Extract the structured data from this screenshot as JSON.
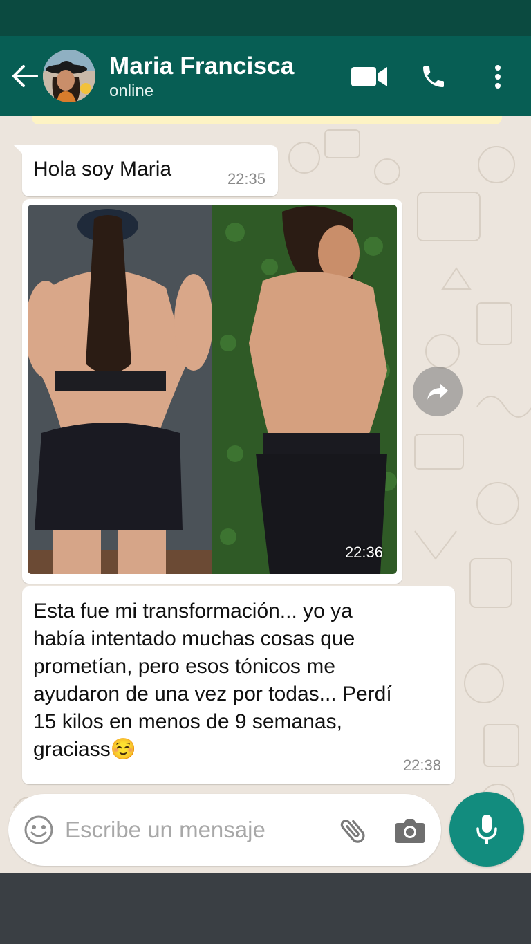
{
  "header": {
    "contact_name": "Maria Francisca",
    "contact_status": "online",
    "back_icon": "arrow-left-icon",
    "video_icon": "video-camera-icon",
    "call_icon": "phone-icon",
    "more_icon": "more-vertical-icon",
    "color": "#075e54"
  },
  "messages": [
    {
      "type": "text",
      "text": "Hola soy Maria",
      "time": "22:35"
    },
    {
      "type": "image",
      "description": "before-after-photo",
      "time": "22:36"
    },
    {
      "type": "text",
      "text": "Esta fue mi transformación... yo ya\nhabía intentado muchas cosas que\nprometían, pero esos tónicos me\nayudaron de una vez por todas... Perdí\n15 kilos en menos de 9 semanas,\ngraciass☺️",
      "time": "22:38"
    }
  ],
  "composer": {
    "placeholder": "Escribe un mensaje",
    "emoji_icon": "emoji-icon",
    "attach_icon": "paperclip-icon",
    "camera_icon": "camera-icon",
    "mic_icon": "microphone-icon",
    "mic_color": "#128c7e"
  },
  "chat": {
    "background": "#ece5dd",
    "forward_icon": "forward-icon"
  }
}
